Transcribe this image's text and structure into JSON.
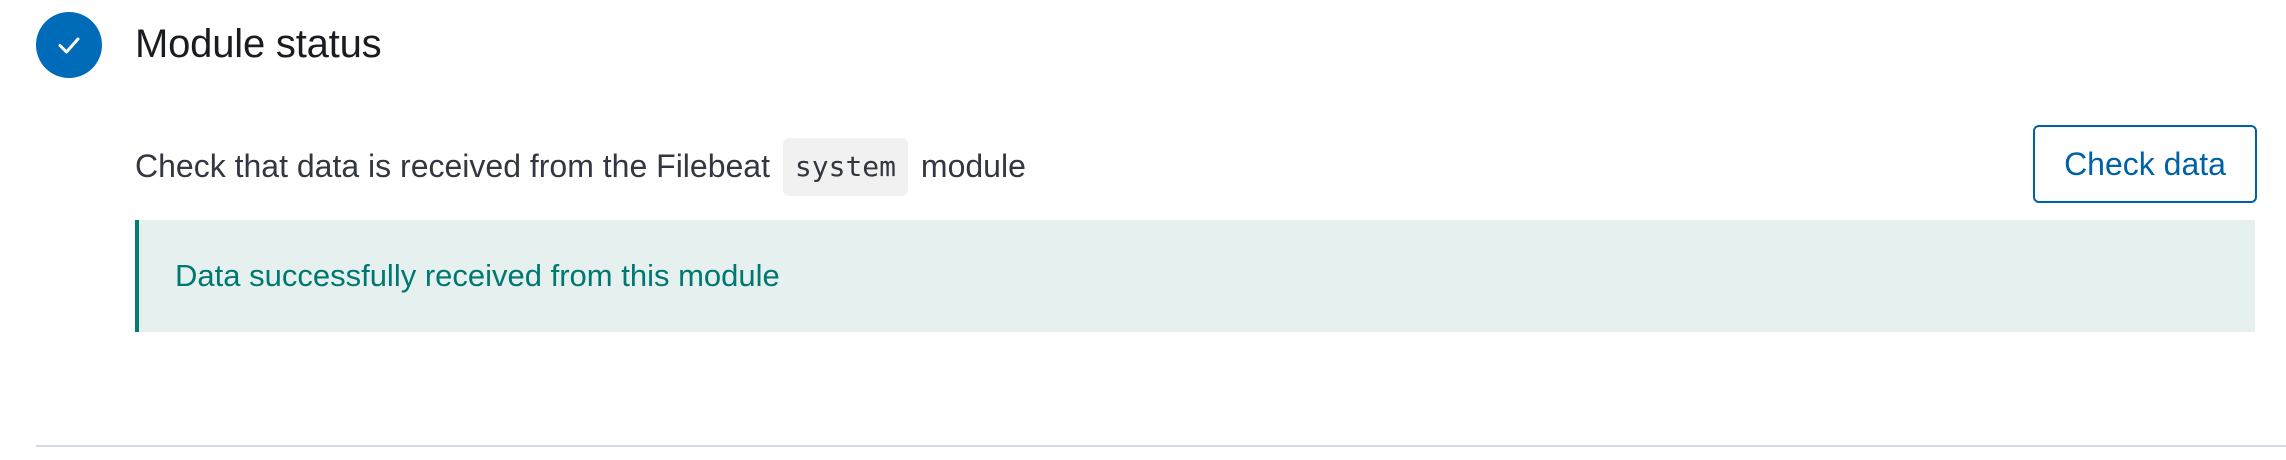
{
  "step": {
    "title": "Module status",
    "status_icon": "check-icon",
    "accent_color": "#006bb8"
  },
  "description": {
    "before": "Check that data is received from the Filebeat",
    "code": "system",
    "after": "module"
  },
  "check_button": {
    "label": "Check data"
  },
  "callout": {
    "message": "Data successfully received from this module",
    "status": "success",
    "color": "#017d73"
  }
}
